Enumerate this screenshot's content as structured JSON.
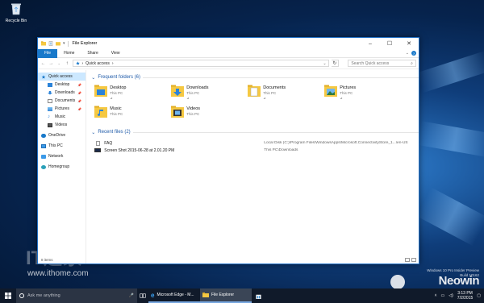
{
  "desktop": {
    "recycle_bin_label": "Recycle Bin",
    "watermark_text": "www.ithome.com",
    "watermark_brand": "Neowin",
    "build_line1": "Windows 10 Pro Insider Preview",
    "build_line2": "Build 10162"
  },
  "window": {
    "title": "File Explorer",
    "ribbon_tabs": [
      "File",
      "Home",
      "Share",
      "View"
    ],
    "address": {
      "path_label": "Quick access",
      "separator": "›"
    },
    "search_placeholder": "Search Quick access",
    "status_text": "8 items"
  },
  "navigation": {
    "items": [
      {
        "label": "Quick access",
        "pinned": false
      },
      {
        "label": "Desktop",
        "pinned": true
      },
      {
        "label": "Downloads",
        "pinned": true
      },
      {
        "label": "Documents",
        "pinned": true
      },
      {
        "label": "Pictures",
        "pinned": true
      },
      {
        "label": "Music",
        "pinned": false
      },
      {
        "label": "Videos",
        "pinned": false
      },
      {
        "label": "OneDrive",
        "pinned": false
      },
      {
        "label": "This PC",
        "pinned": false
      },
      {
        "label": "Network",
        "pinned": false
      },
      {
        "label": "Homegroup",
        "pinned": false
      }
    ]
  },
  "frequent_folders": {
    "heading": "Frequent folders (6)",
    "items": [
      {
        "name": "Desktop",
        "location": "This PC"
      },
      {
        "name": "Downloads",
        "location": "This PC"
      },
      {
        "name": "Documents",
        "location": "This PC"
      },
      {
        "name": "Pictures",
        "location": "This PC"
      },
      {
        "name": "Music",
        "location": "This PC"
      },
      {
        "name": "Videos",
        "location": "This PC"
      }
    ]
  },
  "recent_files": {
    "heading": "Recent files (2)",
    "items": [
      {
        "name": "FAQ",
        "path": "Local Disk (C:)\\Program Files\\WindowsApps\\Microsoft.ConnectivityStore_1...\\en-US"
      },
      {
        "name": "Screen Shot 2015-06-28 at 2.01.20 PM",
        "path": "This PC\\Downloads"
      }
    ]
  },
  "taskbar": {
    "search_placeholder": "Ask me anything",
    "apps": [
      {
        "label": "Microsoft Edge - M...",
        "active": false
      },
      {
        "label": "File Explorer",
        "active": true
      }
    ],
    "time": "3:13 PM",
    "date": "7/2/2015"
  },
  "colors": {
    "accent": "#1979ca",
    "folder": "#f5c842",
    "selection": "#cce8ff"
  }
}
